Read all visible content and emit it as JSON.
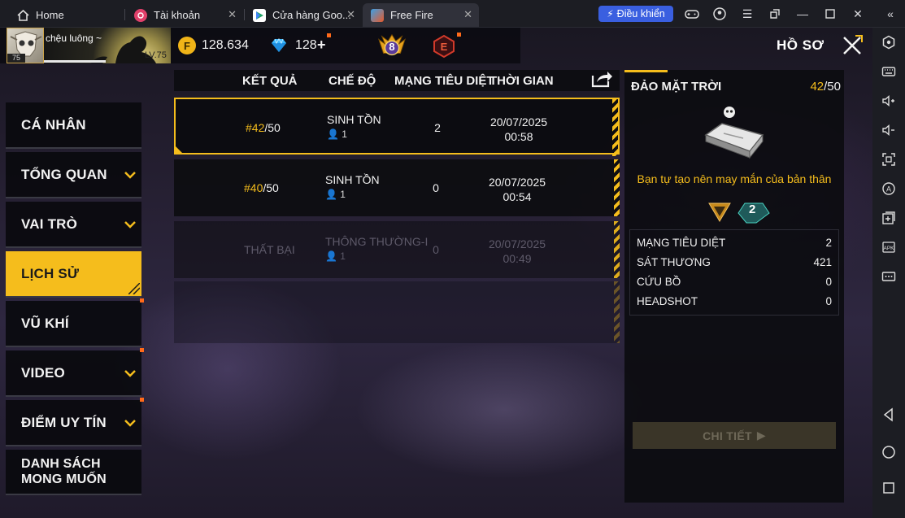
{
  "browser": {
    "tabs": [
      {
        "label": "Home",
        "icon": "home-icon"
      },
      {
        "label": "Tài khoản",
        "icon": "account-icon"
      },
      {
        "label": "Cửa hàng Goo...",
        "icon": "play-store-icon"
      },
      {
        "label": "Free Fire",
        "icon": "free-fire-icon"
      }
    ],
    "control_label": "Điều khiển"
  },
  "player": {
    "name": "chệu luông ~",
    "avatar_level": "75",
    "level_label": "LV.75"
  },
  "currency": {
    "gold": "128.634",
    "diamonds": "128"
  },
  "header": {
    "rank_number": "8",
    "elite_letter": "E",
    "title": "HỒ SƠ"
  },
  "menu": [
    {
      "label": "CÁ NHÂN",
      "chevron": false,
      "dot": false,
      "active": false
    },
    {
      "label": "TỔNG QUAN",
      "chevron": true,
      "dot": false,
      "active": false
    },
    {
      "label": "VAI TRÒ",
      "chevron": true,
      "dot": false,
      "active": false
    },
    {
      "label": "LỊCH SỬ",
      "chevron": false,
      "dot": false,
      "active": true
    },
    {
      "label": "VŨ KHÍ",
      "chevron": false,
      "dot": true,
      "active": false
    },
    {
      "label": "VIDEO",
      "chevron": true,
      "dot": true,
      "active": false
    },
    {
      "label": "ĐIỂM UY TÍN",
      "chevron": true,
      "dot": true,
      "active": false
    },
    {
      "label_line1": "DANH SÁCH",
      "label_line2": "MONG MUỐN",
      "chevron": false,
      "dot": false,
      "active": false
    }
  ],
  "history": {
    "columns": [
      "KẾT QUẢ",
      "CHẾ ĐỘ",
      "MẠNG TIÊU DIỆT",
      "THỜI GIAN"
    ],
    "rows": [
      {
        "rank": "#42",
        "total": "/50",
        "mode": "SINH TỒN",
        "players": "1",
        "kills": "2",
        "date": "20/07/2025",
        "time": "00:58",
        "selected": true
      },
      {
        "rank": "#40",
        "total": "/50",
        "mode": "SINH TỒN",
        "players": "1",
        "kills": "0",
        "date": "20/07/2025",
        "time": "00:54",
        "selected": false
      },
      {
        "rank": "THẤT BẠI",
        "total": "",
        "mode": "THÔNG THƯỜNG-I",
        "players": "1",
        "kills": "0",
        "date": "20/07/2025",
        "time": "00:49",
        "selected": false
      }
    ]
  },
  "detail": {
    "map": "ĐẢO MẶT TRỜI",
    "rank": "42",
    "total": "/50",
    "message": "Bạn tự tạo nên may mắn của bản thân",
    "medal_number": "2",
    "stats": [
      {
        "label": "MẠNG TIÊU DIỆT",
        "value": "2"
      },
      {
        "label": "SÁT THƯƠNG",
        "value": "421"
      },
      {
        "label": "CỨU BỒ",
        "value": "0"
      },
      {
        "label": "HEADSHOT",
        "value": "0"
      }
    ],
    "button": "CHI TIẾT"
  },
  "colors": {
    "accent": "#f5bd1c",
    "notification": "#ff6a1a",
    "control_button": "#3a5fe0"
  }
}
